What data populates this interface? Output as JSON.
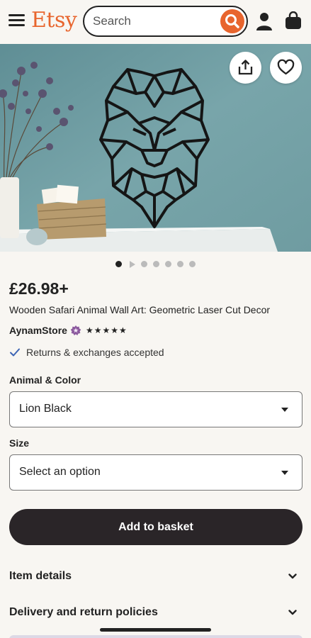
{
  "header": {
    "logo": "Etsy",
    "search_placeholder": "Search"
  },
  "hero": {
    "image_alt": "Geometric lion head wall art on teal wall",
    "dots_count": 7,
    "active_dot": 0
  },
  "product": {
    "price": "£26.98+",
    "title": "Wooden Safari Animal Wall Art: Geometric Laser Cut Decor",
    "shop_name": "AynamStore",
    "rating_stars": "★★★★★",
    "returns_text": "Returns & exchanges accepted"
  },
  "options": {
    "animal_color_label": "Animal & Color",
    "animal_color_value": "Lion Black",
    "size_label": "Size",
    "size_value": "Select an option"
  },
  "actions": {
    "add_to_basket": "Add to basket"
  },
  "accordion": {
    "item_details": "Item details",
    "delivery": "Delivery and return policies"
  },
  "colors": {
    "brand": "#e8652e",
    "primary_button": "#2a2528",
    "background": "#f8f6f2"
  }
}
